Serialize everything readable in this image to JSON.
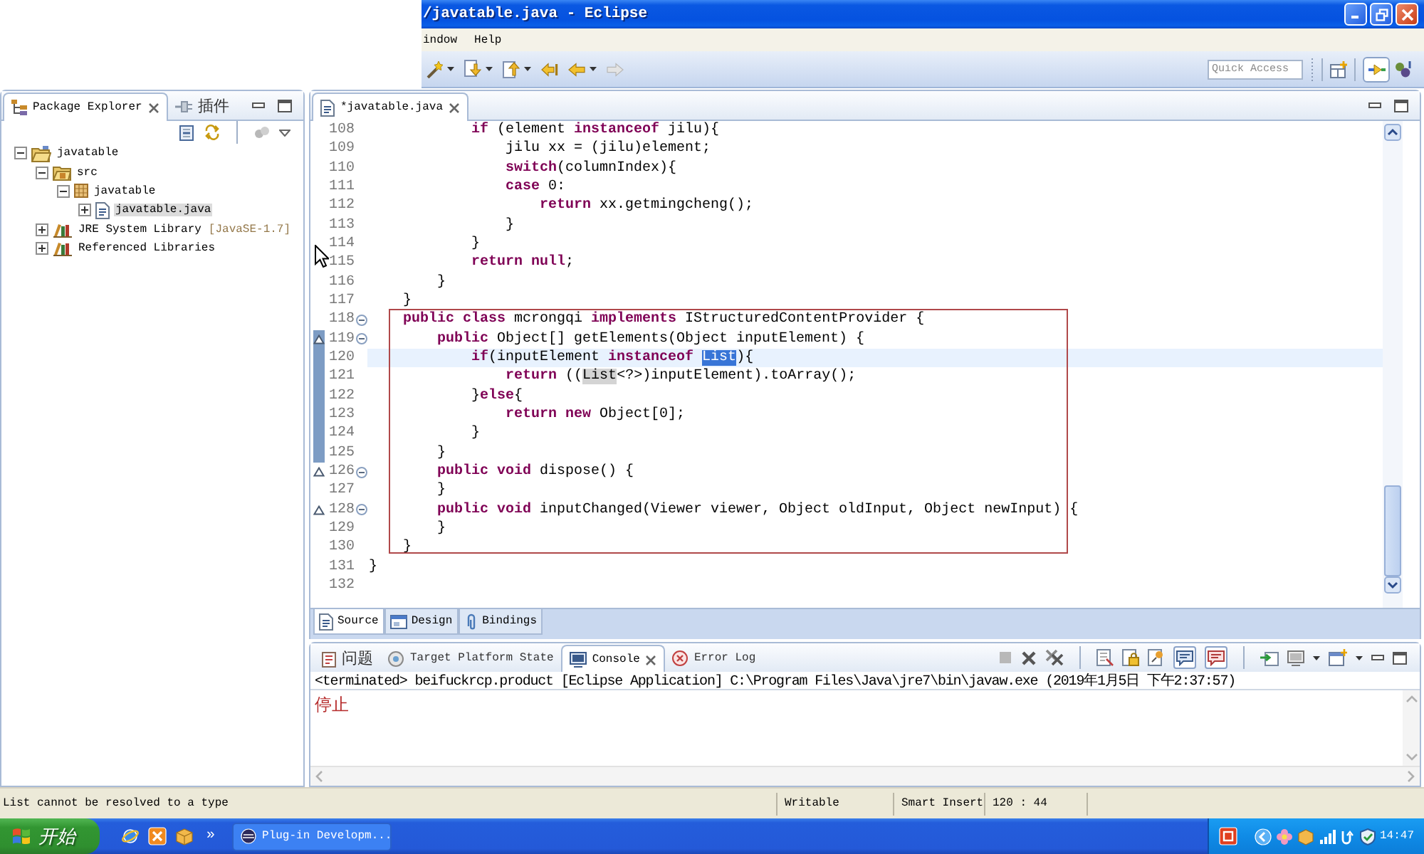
{
  "window": {
    "title": "/javatable.java - Eclipse"
  },
  "menu": [
    "indow",
    "Help"
  ],
  "toolbar": {
    "quick_access": {
      "placeholder": "Quick Access"
    }
  },
  "package_explorer": {
    "tabs": [
      {
        "label": "Package Explorer",
        "selected": true
      },
      {
        "label": "插件",
        "selected": false
      }
    ],
    "tree": [
      {
        "label": "javatable",
        "kind": "project",
        "expanded": true,
        "selected": false,
        "children": [
          {
            "label": "src",
            "kind": "source-folder",
            "expanded": true,
            "selected": false,
            "children": [
              {
                "label": "javatable",
                "kind": "package",
                "expanded": true,
                "selected": false,
                "children": [
                  {
                    "label": "javatable.java",
                    "kind": "java-file",
                    "expanded": false,
                    "selected": true
                  }
                ]
              }
            ]
          },
          {
            "label": "JRE System Library",
            "decoration": "[JavaSE-1.7]",
            "kind": "library",
            "expanded": false,
            "selected": false
          },
          {
            "label": "Referenced Libraries",
            "kind": "library",
            "expanded": false,
            "selected": false
          }
        ]
      }
    ]
  },
  "editor": {
    "tabs": [
      {
        "label": "*javatable.java",
        "selected": true
      }
    ],
    "blocks": [
      {
        "framed": false,
        "lines": [
          {
            "number": "108",
            "segments": [
              {
                "kind": "keyword",
                "text": "            if"
              },
              {
                "kind": "plain",
                "text": " (element "
              },
              {
                "kind": "keyword",
                "text": "instanceof"
              },
              {
                "kind": "plain",
                "text": " jilu){"
              }
            ],
            "current": false,
            "in_range": false
          },
          {
            "number": "109",
            "segments": [
              {
                "kind": "plain",
                "text": "                jilu xx = (jilu)element;"
              }
            ],
            "current": false,
            "in_range": false
          },
          {
            "number": "110",
            "segments": [
              {
                "kind": "keyword",
                "text": "                switch"
              },
              {
                "kind": "plain",
                "text": "(columnIndex){"
              }
            ],
            "current": false,
            "in_range": false
          },
          {
            "number": "111",
            "segments": [
              {
                "kind": "keyword",
                "text": "                case"
              },
              {
                "kind": "plain",
                "text": " 0:"
              }
            ],
            "current": false,
            "in_range": false
          },
          {
            "number": "112",
            "segments": [
              {
                "kind": "keyword",
                "text": "                    return"
              },
              {
                "kind": "plain",
                "text": " xx.getmingcheng();"
              }
            ],
            "current": false,
            "in_range": false
          },
          {
            "number": "113",
            "segments": [
              {
                "kind": "plain",
                "text": "                }"
              }
            ],
            "current": false,
            "in_range": false
          },
          {
            "number": "114",
            "segments": [
              {
                "kind": "plain",
                "text": "            }"
              }
            ],
            "current": false,
            "in_range": false
          },
          {
            "number": "115",
            "segments": [
              {
                "kind": "keyword",
                "text": "            return null"
              },
              {
                "kind": "plain",
                "text": ";"
              }
            ],
            "current": false,
            "in_range": false
          },
          {
            "number": "116",
            "segments": [
              {
                "kind": "plain",
                "text": "        }"
              }
            ],
            "current": false,
            "in_range": false
          },
          {
            "number": "117",
            "segments": [
              {
                "kind": "plain",
                "text": "    }"
              }
            ],
            "current": false,
            "in_range": false
          }
        ]
      },
      {
        "framed": true,
        "lines": [
          {
            "number": "118",
            "segments": [
              {
                "kind": "keyword",
                "text": "    public class"
              },
              {
                "kind": "plain",
                "text": " mcrongqi "
              },
              {
                "kind": "keyword",
                "text": "implements"
              },
              {
                "kind": "plain",
                "text": " IStructuredContentProvider {"
              }
            ],
            "current": false,
            "in_range": false,
            "expanded": true
          },
          {
            "number": "119",
            "segments": [
              {
                "kind": "keyword",
                "text": "        public"
              },
              {
                "kind": "plain",
                "text": " Object[] getElements(Object inputElement) {"
              }
            ],
            "current": false,
            "in_range": true,
            "expanded": true,
            "override": true
          },
          {
            "number": "120",
            "segments": [
              {
                "kind": "keyword",
                "text": "            if"
              },
              {
                "kind": "plain",
                "text": "(inputElement "
              },
              {
                "kind": "keyword",
                "text": "instanceof "
              },
              {
                "kind": "selected",
                "text": "List"
              },
              {
                "kind": "plain",
                "text": "){"
              }
            ],
            "current": true,
            "in_range": true
          },
          {
            "number": "121",
            "segments": [
              {
                "kind": "keyword",
                "text": "                return"
              },
              {
                "kind": "plain",
                "text": " (("
              },
              {
                "kind": "occurrence",
                "text": "List"
              },
              {
                "kind": "plain",
                "text": "<?>)inputElement).toArray();"
              }
            ],
            "current": false,
            "in_range": true
          },
          {
            "number": "122",
            "segments": [
              {
                "kind": "plain",
                "text": "            }"
              },
              {
                "kind": "keyword",
                "text": "else"
              },
              {
                "kind": "plain",
                "text": "{"
              }
            ],
            "current": false,
            "in_range": true
          },
          {
            "number": "123",
            "segments": [
              {
                "kind": "keyword",
                "text": "                return new"
              },
              {
                "kind": "plain",
                "text": " Object[0];"
              }
            ],
            "current": false,
            "in_range": true
          },
          {
            "number": "124",
            "segments": [
              {
                "kind": "plain",
                "text": "            }"
              }
            ],
            "current": false,
            "in_range": true
          },
          {
            "number": "125",
            "segments": [
              {
                "kind": "plain",
                "text": "        }"
              }
            ],
            "current": false,
            "in_range": true
          },
          {
            "number": "126",
            "segments": [
              {
                "kind": "keyword",
                "text": "        public void"
              },
              {
                "kind": "plain",
                "text": " dispose() {"
              }
            ],
            "current": false,
            "in_range": false,
            "expanded": true,
            "override": true
          },
          {
            "number": "127",
            "segments": [
              {
                "kind": "plain",
                "text": "        }"
              }
            ],
            "current": false,
            "in_range": false
          },
          {
            "number": "128",
            "segments": [
              {
                "kind": "keyword",
                "text": "        public void"
              },
              {
                "kind": "plain",
                "text": " inputChanged(Viewer viewer, Object oldInput, Object newInput) {"
              }
            ],
            "current": false,
            "in_range": false,
            "expanded": true,
            "override": true
          },
          {
            "number": "129",
            "segments": [
              {
                "kind": "plain",
                "text": "        }"
              }
            ],
            "current": false,
            "in_range": false
          },
          {
            "number": "130",
            "segments": [
              {
                "kind": "plain",
                "text": "    }"
              }
            ],
            "current": false,
            "in_range": false
          }
        ]
      },
      {
        "framed": false,
        "lines": [
          {
            "number": "131",
            "segments": [
              {
                "kind": "plain",
                "text": "}"
              }
            ],
            "current": false,
            "in_range": false
          },
          {
            "number": "132",
            "current": false,
            "in_range": false
          }
        ]
      }
    ],
    "bottom_tabs": [
      {
        "label": "Source",
        "selected": true
      },
      {
        "label": "Design",
        "selected": false
      },
      {
        "label": "Bindings",
        "selected": false
      }
    ]
  },
  "console": {
    "tabs": [
      {
        "label": "问题",
        "selected": false
      },
      {
        "label": "Target Platform State",
        "selected": false
      },
      {
        "label": "Console",
        "selected": true
      },
      {
        "label": "Error Log",
        "selected": false
      }
    ],
    "process": "<terminated> beifuckrcp.product [Eclipse Application] C:\\Program Files\\Java\\jre7\\bin\\javaw.exe (2019年1月5日 下午2:37:57)",
    "output": "停止"
  },
  "status_bar": {
    "message": "List cannot be resolved to a type",
    "fields": [
      "Writable",
      "Smart Insert",
      "120 : 44"
    ]
  },
  "taskbar": {
    "start": "开始",
    "more": "»",
    "tasks": [
      {
        "label": "Plug-in Developm...",
        "selected": false
      }
    ],
    "clock": "14:47"
  }
}
